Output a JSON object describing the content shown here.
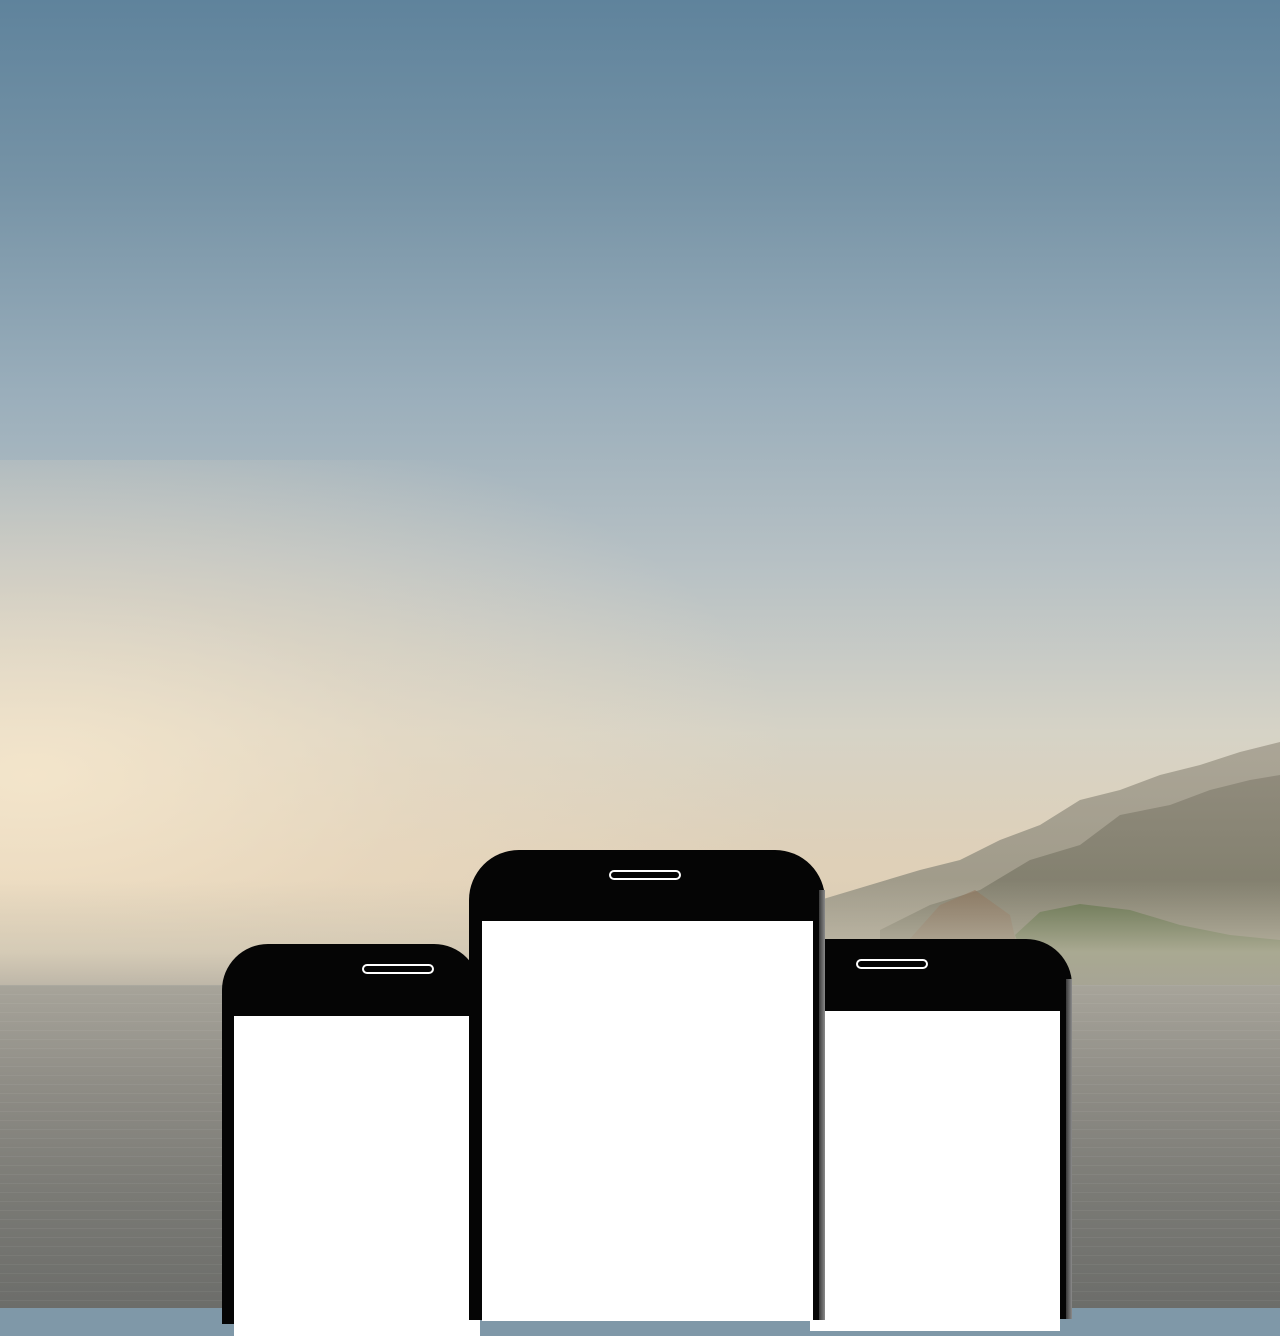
{
  "scene": {
    "description_tags": [
      "sky-background",
      "coastal-mountains",
      "sea",
      "three-phone-mockups"
    ],
    "colors": {
      "sky_top": "#5f839c",
      "sky_horizon": "#e0cfb4",
      "sea": "#7a7a75",
      "phone_body": "#050505",
      "phone_screen": "#ffffff",
      "mountain_far": "#9a9a8a",
      "forest": "#4a5a34"
    }
  },
  "phones": [
    {
      "id": "left",
      "screen_content": ""
    },
    {
      "id": "center",
      "screen_content": ""
    },
    {
      "id": "right",
      "screen_content": ""
    }
  ]
}
